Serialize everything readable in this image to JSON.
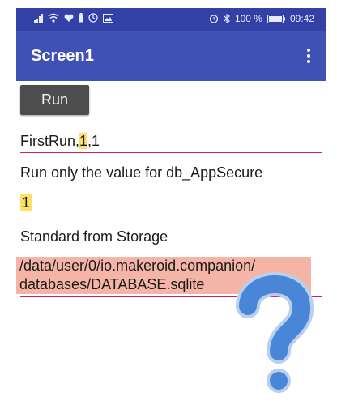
{
  "statusbar": {
    "battery": "100 %",
    "time": "09:42"
  },
  "appbar": {
    "title": "Screen1"
  },
  "run_button": {
    "label": "Run"
  },
  "first_run": {
    "prefix": "FirstRun,",
    "highlight": "1",
    "suffix": ",1"
  },
  "label_appsecure": "Run only the value for db_AppSecure",
  "appsecure_value": "1",
  "label_storage": "Standard from Storage",
  "storage_path": {
    "line1": "/data/user/0/io.makeroid.companion/",
    "line2": "databases/DATABASE.sqlite"
  },
  "colors": {
    "statusbar": "#3341a6",
    "appbar": "#3f51b5",
    "underline": "#d81b60",
    "highlight": "#ffe066",
    "path_bg": "#f4b4a6",
    "question_mark": "#4a86d8"
  },
  "icons": [
    "signal-icon",
    "wifi-icon",
    "heart-icon",
    "battery-small-icon",
    "clock-icon",
    "gallery-icon",
    "alarm-icon",
    "bluetooth-icon",
    "battery-icon",
    "overflow-menu-icon",
    "question-mark-icon"
  ]
}
